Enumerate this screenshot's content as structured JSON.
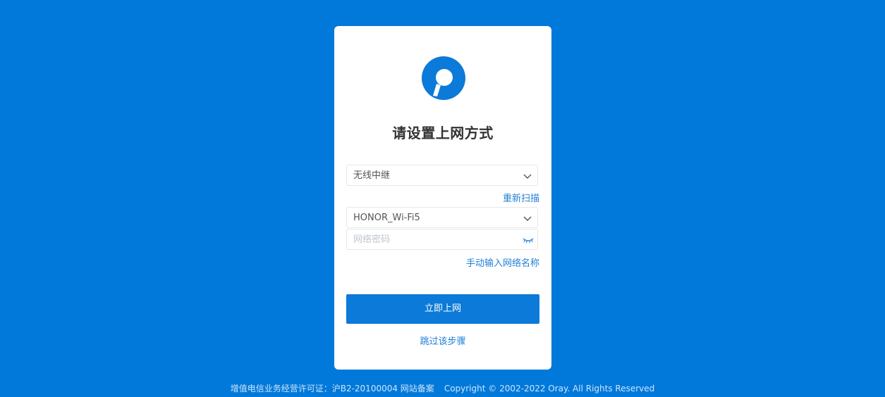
{
  "card": {
    "title": "请设置上网方式"
  },
  "form": {
    "mode_select": {
      "selected": "无线中继"
    },
    "rescan_link": "重新扫描",
    "ssid_select": {
      "selected": "HONOR_Wi-Fi5"
    },
    "password": {
      "placeholder": "网络密码",
      "value": ""
    },
    "manual_link": "手动输入网络名称",
    "submit_label": "立即上网",
    "skip_label": "跳过该步骤"
  },
  "footer": {
    "license": "增值电信业务经营许可证：沪B2-20100004 网站备案",
    "copyright": "Copyright © 2002-2022 Oray. All Rights Reserved"
  },
  "colors": {
    "background": "#0079db",
    "accent": "#0b7ad8",
    "link": "#1f7fd8"
  },
  "icons": {
    "logo": "oray-logo",
    "dropdown": "chevron-down-icon",
    "password_toggle": "eye-closed-icon"
  }
}
